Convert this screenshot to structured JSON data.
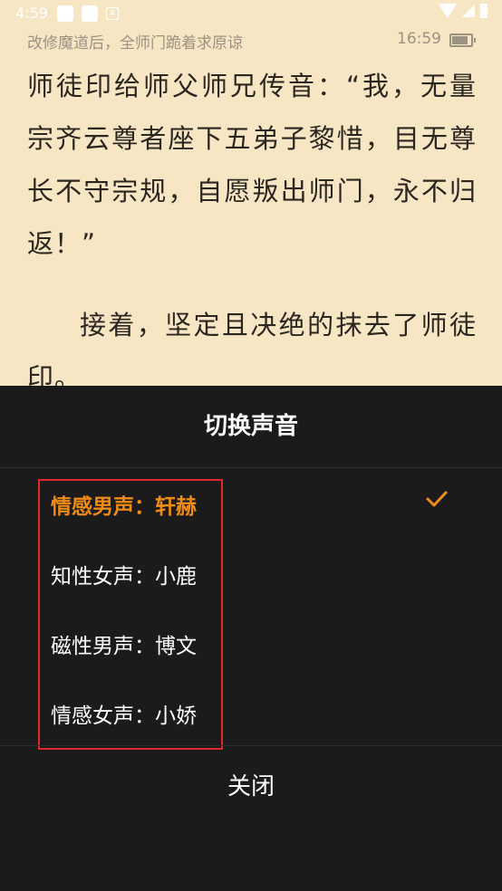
{
  "status_bar": {
    "time": "4:59",
    "small_icon": "A"
  },
  "book": {
    "chapter_title": "改修魔道后，全师门跪着求原谅",
    "clock": "16:59",
    "paragraphs": [
      "师徒印给师父师兄传音：“我，无量宗齐云尊者座下五弟子黎惜，目无尊长不守宗规，自愿叛出师门，永不归返！”",
      "接着，坚定且决绝的抹去了师徒印。"
    ]
  },
  "voice_sheet": {
    "title": "切换声音",
    "options": [
      {
        "label": "情感男声：轩赫",
        "selected": true
      },
      {
        "label": "知性女声：小鹿",
        "selected": false
      },
      {
        "label": "磁性男声：博文",
        "selected": false
      },
      {
        "label": "情感女声：小娇",
        "selected": false
      }
    ],
    "close_label": "关闭",
    "accent_color": "#f08b15",
    "highlight_color": "#e0262e"
  }
}
